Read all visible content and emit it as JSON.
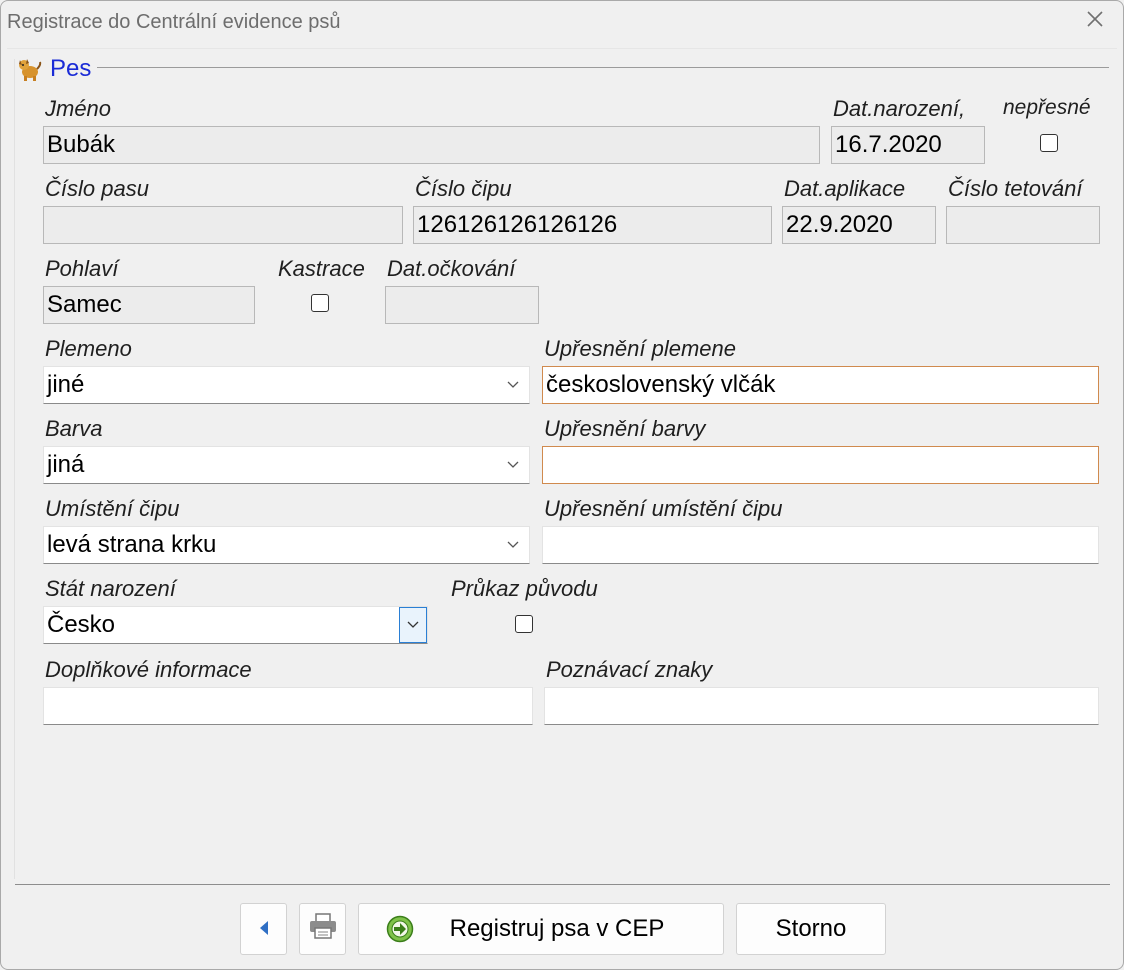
{
  "window": {
    "title": "Registrace do Centrální evidence psů",
    "close_icon": "close-icon"
  },
  "group": {
    "title": "Pes",
    "icon": "dog-icon"
  },
  "fields": {
    "jmeno": {
      "label": "Jméno",
      "value": "Bubák"
    },
    "dat_narozeni": {
      "label": "Dat.narození,",
      "value": "16.7.2020"
    },
    "nepresne": {
      "label": "nepřesné",
      "checked": false
    },
    "cislo_pasu": {
      "label": "Číslo pasu",
      "value": ""
    },
    "cislo_cipu": {
      "label": "Číslo čipu",
      "value": "126126126126126"
    },
    "dat_aplikace": {
      "label": "Dat.aplikace",
      "value": "22.9.2020"
    },
    "cislo_tetovani": {
      "label": "Číslo tetování",
      "value": ""
    },
    "pohlavi": {
      "label": "Pohlaví",
      "value": "Samec"
    },
    "kastrace": {
      "label": "Kastrace",
      "checked": false
    },
    "dat_ockovani": {
      "label": "Dat.očkování",
      "value": ""
    },
    "plemeno": {
      "label": "Plemeno",
      "value": "jiné"
    },
    "upresneni_plemene": {
      "label": "Upřesnění plemene",
      "value": "československý vlčák"
    },
    "barva": {
      "label": "Barva",
      "value": "jiná"
    },
    "upresneni_barvy": {
      "label": "Upřesnění barvy",
      "value": ""
    },
    "umisteni_cipu": {
      "label": "Umístění čipu",
      "value": "levá strana krku"
    },
    "upresneni_umisteni_cipu": {
      "label": "Upřesnění umístění čipu",
      "value": ""
    },
    "stat_narozeni": {
      "label": "Stát narození",
      "value": "Česko"
    },
    "prukaz_puvodu": {
      "label": "Průkaz původu",
      "checked": false
    },
    "doplnkove_informace": {
      "label": "Doplňkové informace",
      "value": ""
    },
    "poznavaci_znaky": {
      "label": "Poznávací znaky",
      "value": ""
    }
  },
  "buttons": {
    "back": {
      "icon": "back-arrow-icon"
    },
    "print": {
      "icon": "printer-icon"
    },
    "register": {
      "label": "Registruj psa v CEP",
      "icon": "go-arrow-icon"
    },
    "cancel": {
      "label": "Storno"
    }
  },
  "colors": {
    "group_title": "#1a2bd6",
    "focus_border": "#d08a4e",
    "dropdown_border": "#2a7fd4"
  }
}
